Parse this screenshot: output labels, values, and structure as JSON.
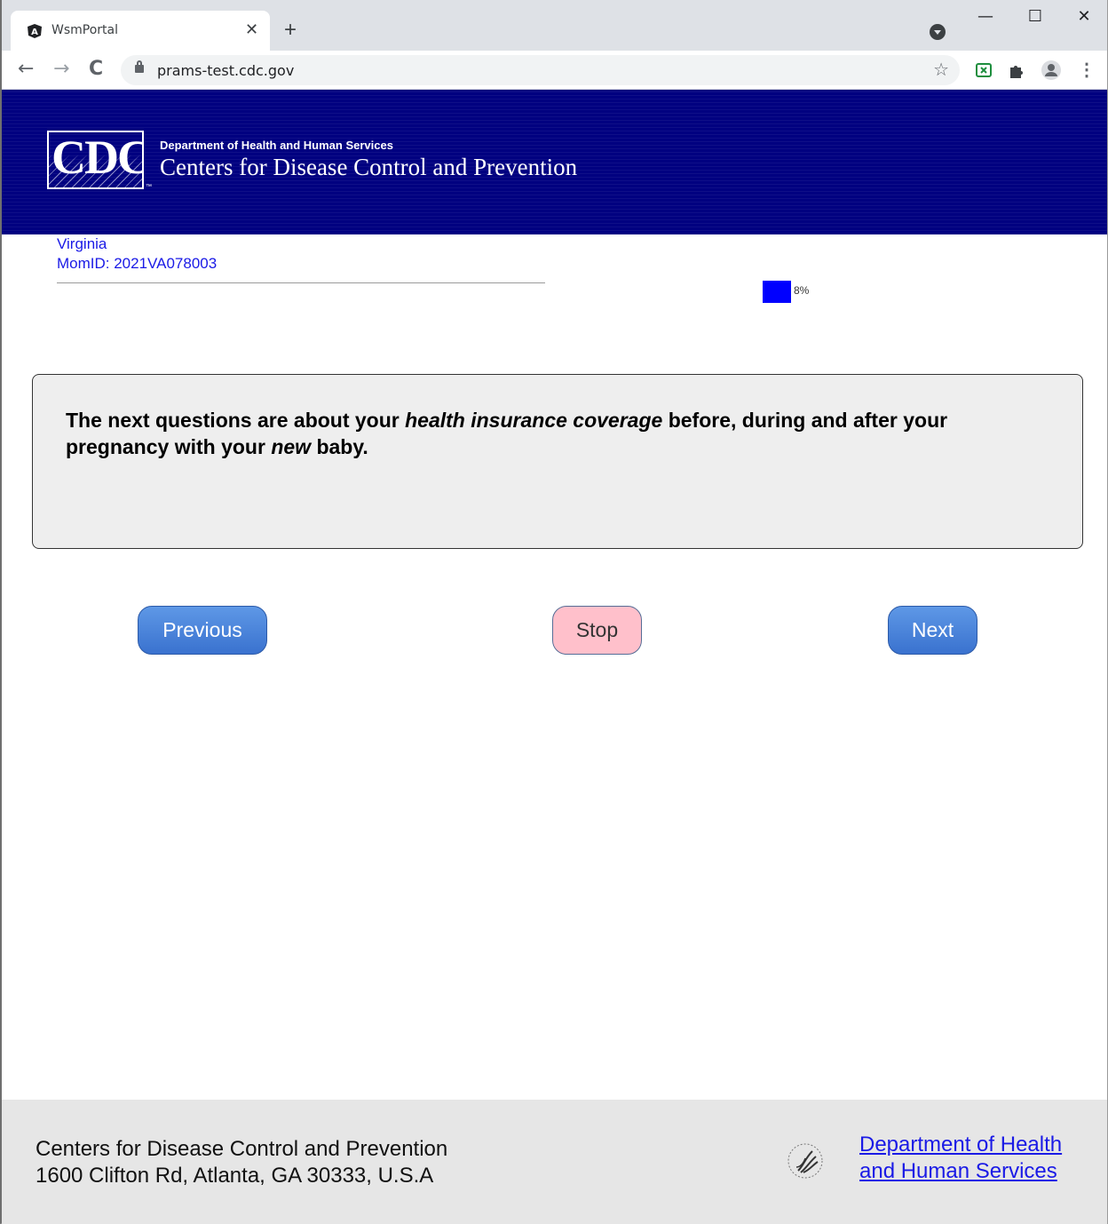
{
  "browser": {
    "tab_title": "WsmPortal",
    "tab_close": "✕",
    "new_tab": "+",
    "url": "prams-test.cdc.gov",
    "back": "←",
    "forward": "→",
    "reload": "C",
    "star": "☆",
    "menu": "⋮",
    "minimize": "—",
    "maximize": "☐",
    "close": "✕"
  },
  "header": {
    "logo_text": "CDC",
    "department": "Department of Health and Human Services",
    "agency": "Centers for Disease Control and Prevention"
  },
  "info": {
    "state": "Virginia",
    "mom_id": "MomID: 2021VA078003",
    "progress_label": "8%",
    "progress_value": 8
  },
  "question": {
    "part1": "The next questions are about your ",
    "em1": "health insurance coverage",
    "part2": " before, during and after your pregnancy with your ",
    "em2": "new",
    "part3": " baby."
  },
  "buttons": {
    "previous": "Previous",
    "stop": "Stop",
    "next": "Next"
  },
  "footer": {
    "line1": "Centers for Disease Control and Prevention",
    "line2": "1600 Clifton Rd, Atlanta, GA 30333, U.S.A",
    "hhs_line1": "Department of Health",
    "hhs_line2": "and Human Services"
  },
  "colors": {
    "header_bg": "#000080",
    "link": "#1a1ae6",
    "progress": "#0000ff",
    "button_blue": "#4a84db",
    "button_stop": "#ffc0cb"
  }
}
